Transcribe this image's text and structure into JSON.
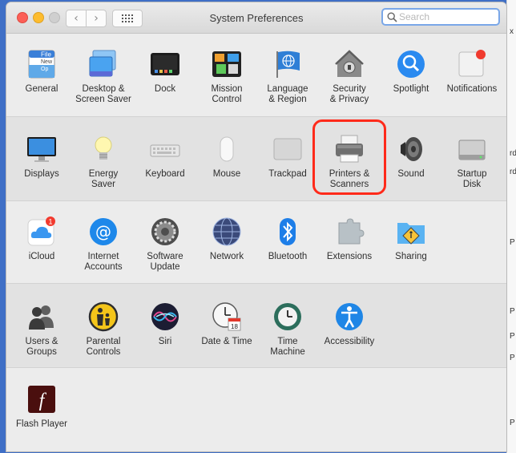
{
  "window": {
    "title": "System Preferences",
    "search": {
      "placeholder": "Search",
      "value": ""
    },
    "nav": {
      "back": "‹",
      "forward": "›"
    }
  },
  "rows": [
    {
      "panes": [
        {
          "name": "general",
          "label": "General",
          "icon": "general-icon"
        },
        {
          "name": "desktop-screen-saver",
          "label": "Desktop &\nScreen Saver",
          "icon": "desktop-icon"
        },
        {
          "name": "dock",
          "label": "Dock",
          "icon": "dock-icon"
        },
        {
          "name": "mission-control",
          "label": "Mission\nControl",
          "icon": "mission-control-icon"
        },
        {
          "name": "language-region",
          "label": "Language\n& Region",
          "icon": "globe-flag-icon"
        },
        {
          "name": "security-privacy",
          "label": "Security\n& Privacy",
          "icon": "house-lock-icon"
        },
        {
          "name": "spotlight",
          "label": "Spotlight",
          "icon": "magnifier-icon"
        },
        {
          "name": "notifications",
          "label": "Notifications",
          "icon": "notifications-icon"
        }
      ]
    },
    {
      "panes": [
        {
          "name": "displays",
          "label": "Displays",
          "icon": "display-icon"
        },
        {
          "name": "energy-saver",
          "label": "Energy\nSaver",
          "icon": "lightbulb-icon"
        },
        {
          "name": "keyboard",
          "label": "Keyboard",
          "icon": "keyboard-icon"
        },
        {
          "name": "mouse",
          "label": "Mouse",
          "icon": "mouse-icon"
        },
        {
          "name": "trackpad",
          "label": "Trackpad",
          "icon": "trackpad-icon"
        },
        {
          "name": "printers-scanners",
          "label": "Printers &\nScanners",
          "icon": "printer-icon"
        },
        {
          "name": "sound",
          "label": "Sound",
          "icon": "speaker-icon"
        },
        {
          "name": "startup-disk",
          "label": "Startup\nDisk",
          "icon": "hard-disk-icon"
        }
      ]
    },
    {
      "panes": [
        {
          "name": "icloud",
          "label": "iCloud",
          "icon": "cloud-icon",
          "badge": "1"
        },
        {
          "name": "internet-accounts",
          "label": "Internet\nAccounts",
          "icon": "at-sign-icon"
        },
        {
          "name": "software-update",
          "label": "Software\nUpdate",
          "icon": "gear-icon"
        },
        {
          "name": "network",
          "label": "Network",
          "icon": "network-globe-icon"
        },
        {
          "name": "bluetooth",
          "label": "Bluetooth",
          "icon": "bluetooth-icon"
        },
        {
          "name": "extensions",
          "label": "Extensions",
          "icon": "puzzle-icon"
        },
        {
          "name": "sharing",
          "label": "Sharing",
          "icon": "sharing-folder-icon"
        }
      ]
    },
    {
      "panes": [
        {
          "name": "users-groups",
          "label": "Users &\nGroups",
          "icon": "users-icon"
        },
        {
          "name": "parental-controls",
          "label": "Parental\nControls",
          "icon": "parental-icon"
        },
        {
          "name": "siri",
          "label": "Siri",
          "icon": "siri-icon"
        },
        {
          "name": "date-time",
          "label": "Date & Time",
          "icon": "clock-calendar-icon",
          "calendar_day": "18"
        },
        {
          "name": "time-machine",
          "label": "Time\nMachine",
          "icon": "time-machine-icon"
        },
        {
          "name": "accessibility",
          "label": "Accessibility",
          "icon": "accessibility-icon"
        }
      ]
    },
    {
      "panes": [
        {
          "name": "flash-player",
          "label": "Flash Player",
          "icon": "flash-icon",
          "glyph": "f"
        }
      ]
    }
  ],
  "general_icon_text": {
    "top": "File",
    "middle": "New",
    "bottom": "Op"
  },
  "background_edge_chars": [
    "x",
    "rd",
    "rd",
    "P",
    "P",
    "P",
    "P",
    "P"
  ],
  "colors": {
    "accent": "#3478f6",
    "highlight": "#ff2a1a",
    "close": "#fc5f57",
    "minimize": "#fdbc2e"
  }
}
